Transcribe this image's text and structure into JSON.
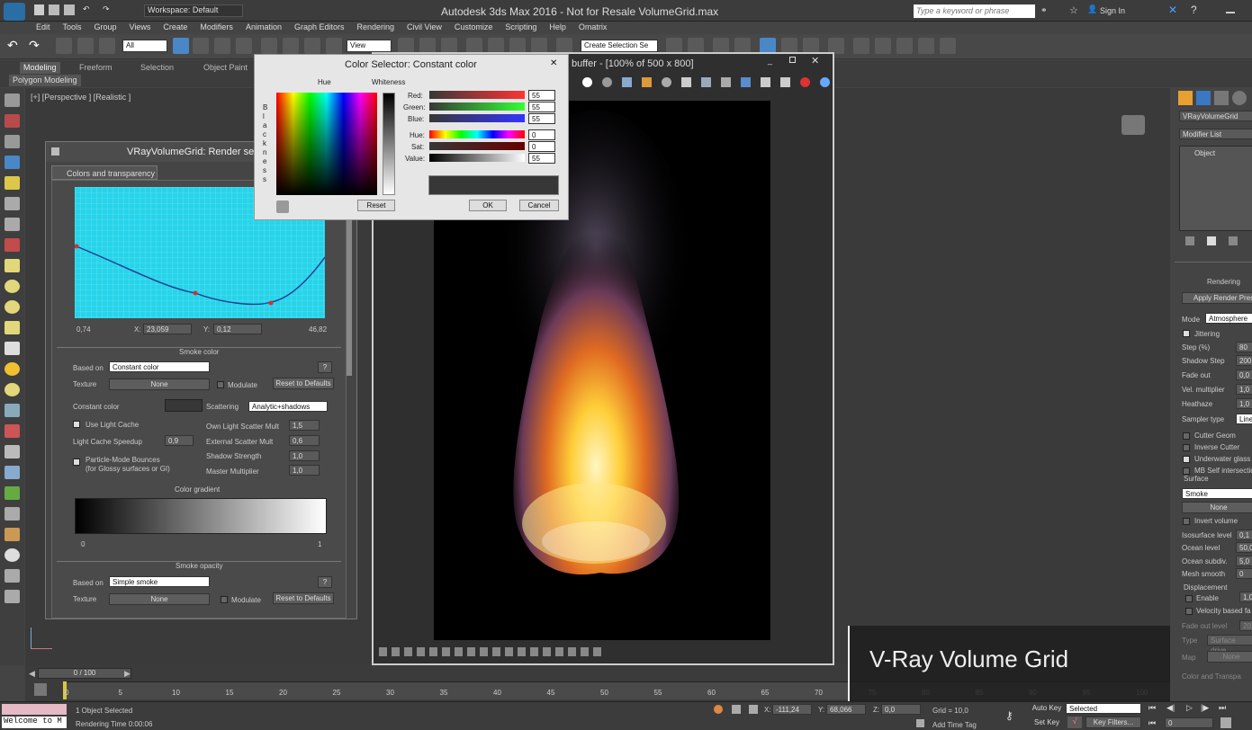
{
  "app": {
    "title": "Autodesk 3ds Max 2016 - Not for Resale   VolumeGrid.max",
    "workspace": "Workspace: Default",
    "search_placeholder": "Type a keyword or phrase",
    "sign_in": "Sign In"
  },
  "menus": [
    "Edit",
    "Tools",
    "Group",
    "Views",
    "Create",
    "Modifiers",
    "Animation",
    "Graph Editors",
    "Rendering",
    "Civil View",
    "Customize",
    "Scripting",
    "Help",
    "Omatrix"
  ],
  "toolbar": {
    "filter": "All",
    "view": "View",
    "selection_set": "Create Selection Se"
  },
  "ribbon": {
    "tabs": [
      "Modeling",
      "Freeform",
      "Selection",
      "Object Paint"
    ],
    "sub": "Polygon Modeling"
  },
  "viewport": {
    "label": "[+] [Perspective ] [Realistic ]"
  },
  "vray_window": {
    "title": "VRayVolumeGrid: Render se",
    "tab": "Colors and transparency",
    "curve_axes": {
      "min": "0,74",
      "max": "46,82",
      "x_label": "X:",
      "x_value": "23,059",
      "y_label": "Y:",
      "y_value": "0,12"
    },
    "smoke_color": {
      "header": "Smoke color",
      "based_on_label": "Based on",
      "based_on": "Constant color",
      "texture_label": "Texture",
      "texture": "None",
      "modulate": "Modulate",
      "reset": "Reset to Defaults",
      "help": "?",
      "constant_color": "Constant color",
      "scattering_label": "Scattering",
      "scattering": "Analytic+shadows",
      "use_light_cache": "Use Light Cache",
      "light_cache_speedup": "Light Cache Speedup",
      "light_cache_speedup_val": "0,9",
      "own_light": "Own Light Scatter Mult",
      "own_light_val": "1,5",
      "external_scatter": "External Scatter Mult",
      "external_scatter_val": "0,6",
      "particle_mode": "Particle-Mode Bounces",
      "particle_mode_note": "(for Glossy surfaces or GI)",
      "shadow_strength": "Shadow Strength",
      "shadow_strength_val": "1,0",
      "master_mult": "Master Multiplier",
      "master_mult_val": "1,0",
      "gradient_label": "Color gradient",
      "grad_min": "0",
      "grad_max": "1"
    },
    "smoke_opacity": {
      "header": "Smoke opacity",
      "based_on_label": "Based on",
      "based_on": "Simple smoke",
      "texture_label": "Texture",
      "texture": "None",
      "modulate": "Modulate",
      "reset": "Reset to Defaults",
      "help": "?"
    }
  },
  "frame_buffer": {
    "title": "buffer - [100% of 500 x 800]"
  },
  "color_selector": {
    "title": "Color Selector: Constant color",
    "hue_label": "Hue",
    "whiteness_label": "Whiteness",
    "blackness_label": "Blackness",
    "channels": [
      {
        "name": "Red:",
        "value": "55"
      },
      {
        "name": "Green:",
        "value": "55"
      },
      {
        "name": "Blue:",
        "value": "55"
      },
      {
        "name": "Hue:",
        "value": "0"
      },
      {
        "name": "Sat:",
        "value": "0"
      },
      {
        "name": "Value:",
        "value": "55"
      }
    ],
    "reset": "Reset",
    "ok": "OK",
    "cancel": "Cancel"
  },
  "command_panel": {
    "object_name": "VRayVolumeGrid",
    "modifier_list": "Modifier List",
    "object": "Object",
    "rendering": "Rendering",
    "apply_preset": "Apply Render Pres",
    "rows": [
      {
        "label": "Mode",
        "value": "Atmosphere"
      },
      {
        "label": "Jittering",
        "value": ""
      },
      {
        "label": "Step (%)",
        "value": "80"
      },
      {
        "label": "Shadow Step",
        "value": "200"
      },
      {
        "label": "Fade out",
        "value": "0,0"
      },
      {
        "label": "Vel. multiplier",
        "value": "1,0"
      },
      {
        "label": "Heathaze",
        "value": "1,0"
      },
      {
        "label": "Sampler type",
        "value": "Linea"
      }
    ],
    "checks": [
      "Cutter Geom",
      "Inverse Cutter",
      "Underwater glass",
      "MB Self intersectio"
    ],
    "surface": "Surface",
    "surface_val": "Smoke",
    "none": "None",
    "invert": "Invert volume",
    "rows2": [
      {
        "label": "Isosurface level",
        "value": "0,1"
      },
      {
        "label": "Ocean level",
        "value": "50,0"
      },
      {
        "label": "Ocean subdiv.",
        "value": "5,0"
      },
      {
        "label": "Mesh smooth",
        "value": "0"
      }
    ],
    "displacement": "Displacement",
    "enable": "Enable",
    "enable_val": "1,0",
    "velocity": "Velocity based fa",
    "fadeout": "Fade out level",
    "fadeout_val": "20,0",
    "type": "Type",
    "type_val": "Surface drive",
    "map": "Map",
    "map_val": "None",
    "color_transp": "Color and Transpa"
  },
  "timeline": {
    "range": "0 / 100",
    "ticks": [
      "0",
      "5",
      "10",
      "15",
      "20",
      "25",
      "30",
      "35",
      "40",
      "45",
      "50",
      "55",
      "60",
      "65",
      "70",
      "75",
      "80",
      "85",
      "90",
      "95",
      "100"
    ]
  },
  "status": {
    "script": "Welcome to M",
    "selected": "1 Object Selected",
    "render_time": "Rendering Time  0:00:06",
    "x_label": "X:",
    "x": "-111,24",
    "y_label": "Y:",
    "y": "68,066",
    "z_label": "Z:",
    "z": "0,0",
    "grid": "Grid = 10,0",
    "add_tag": "Add Time Tag",
    "auto_key": "Auto Key",
    "set_key": "Set Key",
    "selected_mode": "Selected",
    "key_filters": "Key Filters...",
    "frame": "0"
  },
  "overlay": {
    "text": "V-Ray Volume Grid"
  }
}
